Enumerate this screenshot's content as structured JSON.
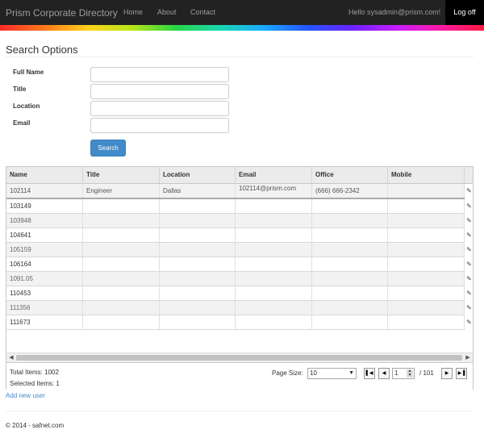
{
  "navbar": {
    "brand": "Prism Corporate Directory",
    "links": [
      "Home",
      "About",
      "Contact"
    ],
    "hello": "Hello sysadmin@prism.com!",
    "logoff": "Log off"
  },
  "search": {
    "title": "Search Options",
    "fields": [
      {
        "label": "Full Name",
        "value": ""
      },
      {
        "label": "Title",
        "value": ""
      },
      {
        "label": "Location",
        "value": ""
      },
      {
        "label": "Email",
        "value": ""
      }
    ],
    "button": "Search"
  },
  "grid": {
    "columns": [
      "Name",
      "Title",
      "Location",
      "Email",
      "Office",
      "Mobile"
    ],
    "rows": [
      {
        "name": "102114",
        "title": "Engineer",
        "location": "Dallas",
        "email": "102114@prism.com",
        "office": "(666) 666-2342",
        "mobile": ""
      },
      {
        "name": "103149",
        "title": "",
        "location": "",
        "email": "",
        "office": "",
        "mobile": ""
      },
      {
        "name": "103948",
        "title": "",
        "location": "",
        "email": "",
        "office": "",
        "mobile": ""
      },
      {
        "name": "104641",
        "title": "",
        "location": "",
        "email": "",
        "office": "",
        "mobile": ""
      },
      {
        "name": "105159",
        "title": "",
        "location": "",
        "email": "",
        "office": "",
        "mobile": ""
      },
      {
        "name": "106164",
        "title": "",
        "location": "",
        "email": "",
        "office": "",
        "mobile": ""
      },
      {
        "name": "1091.05",
        "title": "",
        "location": "",
        "email": "",
        "office": "",
        "mobile": ""
      },
      {
        "name": "110453",
        "title": "",
        "location": "",
        "email": "",
        "office": "",
        "mobile": ""
      },
      {
        "name": "111356",
        "title": "",
        "location": "",
        "email": "",
        "office": "",
        "mobile": ""
      },
      {
        "name": "111673",
        "title": "",
        "location": "",
        "email": "",
        "office": "",
        "mobile": ""
      }
    ],
    "footer": {
      "total": "Total Items: 1002",
      "selected": "Selected Items: 1",
      "page_size_label": "Page Size:",
      "page_size": "10",
      "current_page": "1",
      "of_pages": "/ 101"
    }
  },
  "add_user": "Add new user",
  "copyright": "© 2014 - safnet.com"
}
